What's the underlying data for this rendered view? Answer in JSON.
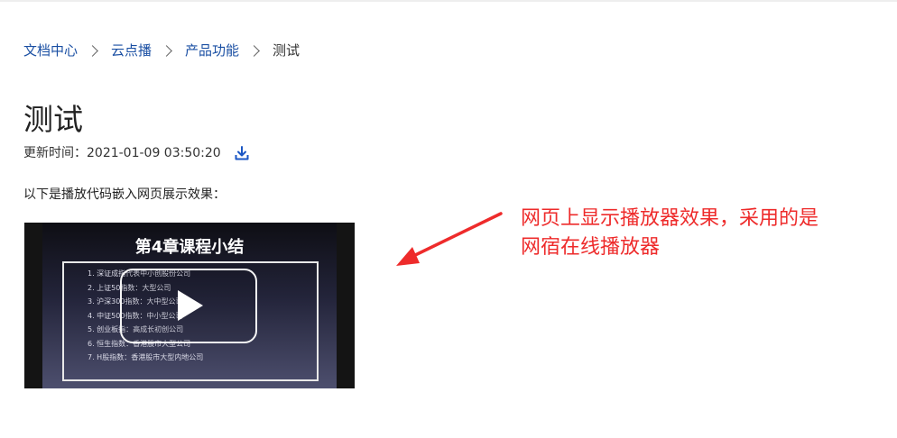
{
  "breadcrumb": {
    "items": [
      "文档中心",
      "云点播",
      "产品功能"
    ],
    "current": "测试"
  },
  "page": {
    "title": "测试",
    "update_label": "更新时间：",
    "update_time": "2021-01-09 03:50:20",
    "intro": "以下是播放代码嵌入网页展示效果："
  },
  "player": {
    "slide_title": "第4章课程小结",
    "slide_items": [
      "1. 深证成指代表中小创股份公司",
      "2. 上证50指数：大型公司",
      "3. 沪深300指数：大中型公司",
      "4. 中证500指数：中小型公司",
      "5. 创业板指：高成长初创公司",
      "6. 恒生指数：香港股市大型公司",
      "7. H股指数：香港股市大型内地公司"
    ]
  },
  "annotation": {
    "line1": "网页上显示播放器效果，采用的是",
    "line2": "网宿在线播放器",
    "color": "#ee2b2b"
  },
  "colors": {
    "link": "#1a4fa3",
    "download_icon": "#1a56c4"
  }
}
